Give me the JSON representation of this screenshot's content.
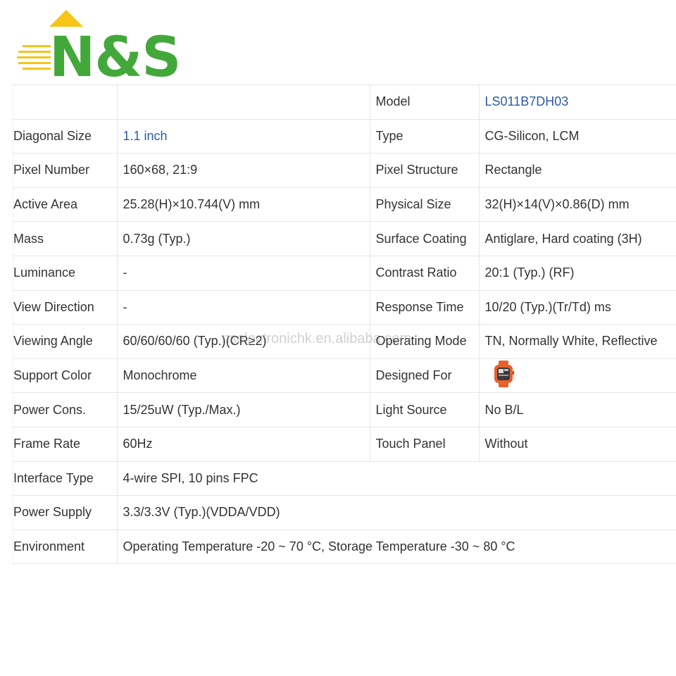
{
  "brand": {
    "logo_text": "N&S",
    "accent_color": "#43a83a",
    "highlight_color": "#f5c518"
  },
  "watermark": "nselectronichk.en.alibaba.com",
  "specs": {
    "model_label": "Model",
    "model_value": "LS011B7DH03",
    "pairs": [
      {
        "left_label": "Diagonal Size",
        "left_value": "1.1 inch",
        "right_label": "Type",
        "right_value": "CG-Silicon, LCM"
      },
      {
        "left_label": "Pixel Number",
        "left_value": "160×68, 21:9",
        "right_label": "Pixel Structure",
        "right_value": "Rectangle"
      },
      {
        "left_label": "Active Area",
        "left_value": "25.28(H)×10.744(V) mm",
        "right_label": "Physical Size",
        "right_value": "32(H)×14(V)×0.86(D) mm"
      },
      {
        "left_label": "Mass",
        "left_value": "0.73g (Typ.)",
        "right_label": "Surface Coating",
        "right_value": "Antiglare, Hard coating (3H)"
      },
      {
        "left_label": "Luminance",
        "left_value": "-",
        "right_label": "Contrast Ratio",
        "right_value": "20:1 (Typ.) (RF)"
      },
      {
        "left_label": "View Direction",
        "left_value": "-",
        "right_label": "Response Time",
        "right_value": "10/20 (Typ.)(Tr/Td) ms"
      },
      {
        "left_label": "Viewing Angle",
        "left_value": "60/60/60/60 (Typ.)(CR≥2)",
        "right_label": "Operating Mode",
        "right_value": "TN, Normally White, Reflective"
      },
      {
        "left_label": "Support Color",
        "left_value": "Monochrome",
        "right_label": "Designed For",
        "right_value": ""
      },
      {
        "left_label": "Power Cons.",
        "left_value": "15/25uW (Typ./Max.)",
        "right_label": "Light Source",
        "right_value": "No B/L"
      },
      {
        "left_label": "Frame Rate",
        "left_value": "60Hz",
        "right_label": "Touch Panel",
        "right_value": "Without"
      }
    ],
    "wide": [
      {
        "label": "Interface Type",
        "value": "4-wire SPI, 10 pins FPC"
      },
      {
        "label": "Power Supply",
        "value": "3.3/3.3V (Typ.)(VDDA/VDD)"
      },
      {
        "label": "Environment",
        "value": "Operating Temperature -20 ~ 70 °C, Storage Temperature -30 ~ 80 °C"
      }
    ]
  }
}
